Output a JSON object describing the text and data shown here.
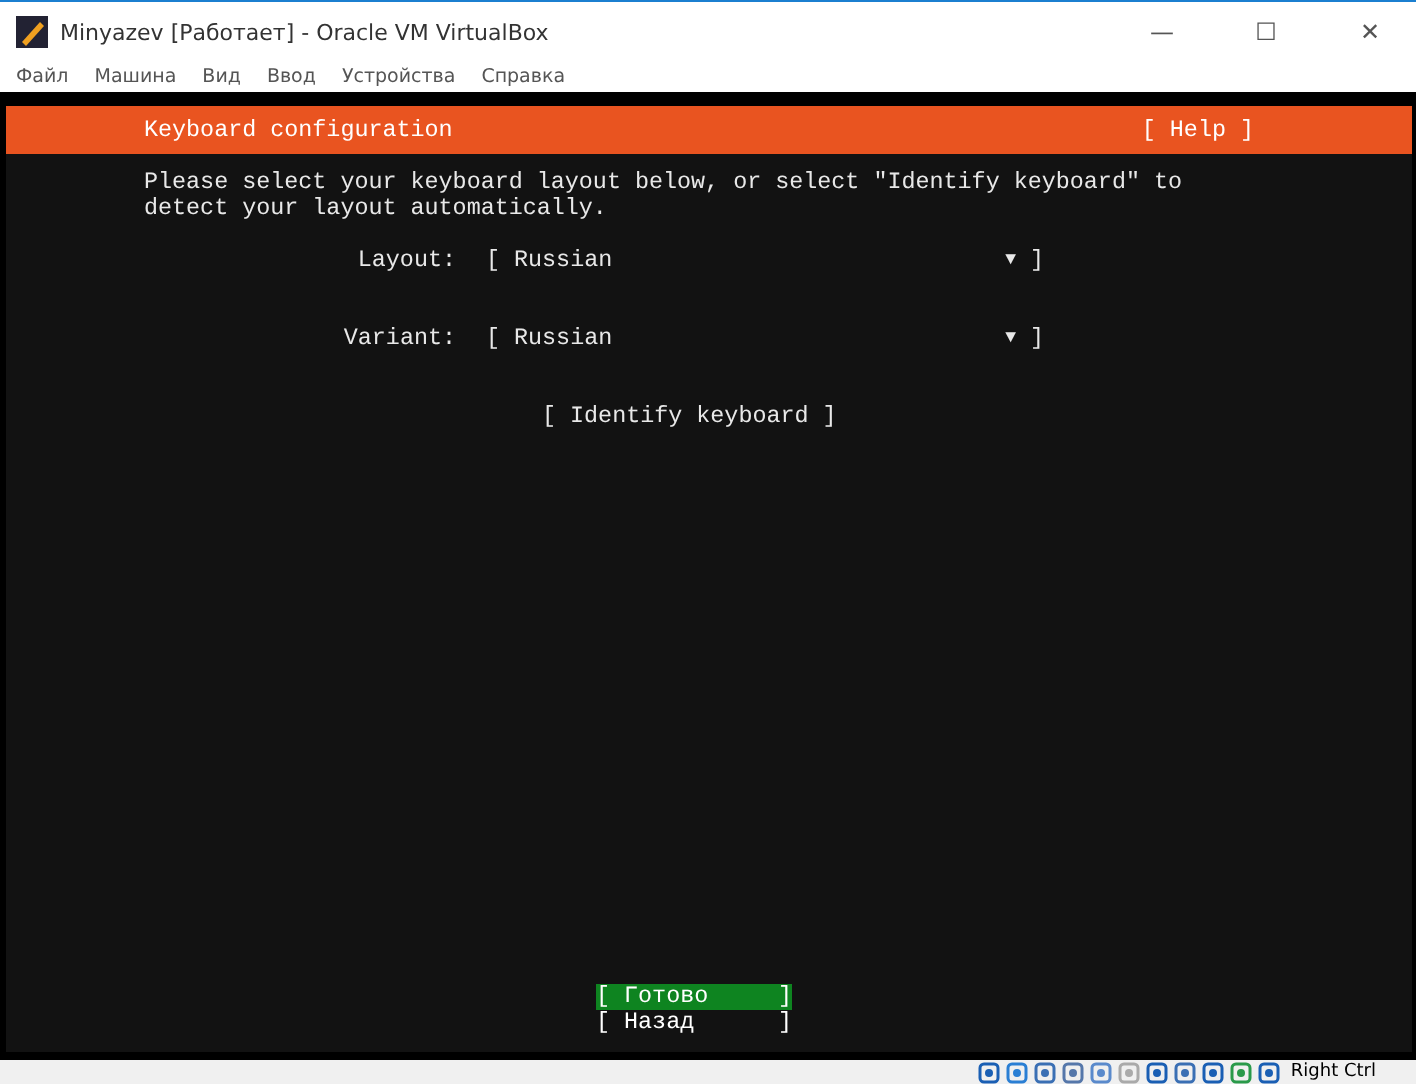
{
  "window": {
    "title": "Minyazev [Работает] - Oracle VM VirtualBox",
    "controls": [
      "—",
      "☐",
      "✕"
    ]
  },
  "menu": [
    "Файл",
    "Машина",
    "Вид",
    "Ввод",
    "Устройства",
    "Справка"
  ],
  "header": {
    "title": "Keyboard configuration",
    "help": "[ Help ]"
  },
  "intro": [
    "Please select your keyboard layout below, or select \"Identify keyboard\" to",
    "detect your layout automatically."
  ],
  "fields": [
    {
      "label": "Layout:",
      "open": "[",
      "value": "Russian",
      "arrow": "▼",
      "close": "]"
    },
    {
      "label": "Variant:",
      "open": "[",
      "value": "Russian",
      "arrow": "▼",
      "close": "]"
    }
  ],
  "identify": "[ Identify keyboard ]",
  "buttons": [
    {
      "open": "[",
      "label": "Готово",
      "close": "]",
      "selected": true
    },
    {
      "open": "[",
      "label": "Назад",
      "close": "]",
      "selected": false
    }
  ],
  "status_bar": {
    "host_key": "Right Ctrl"
  }
}
